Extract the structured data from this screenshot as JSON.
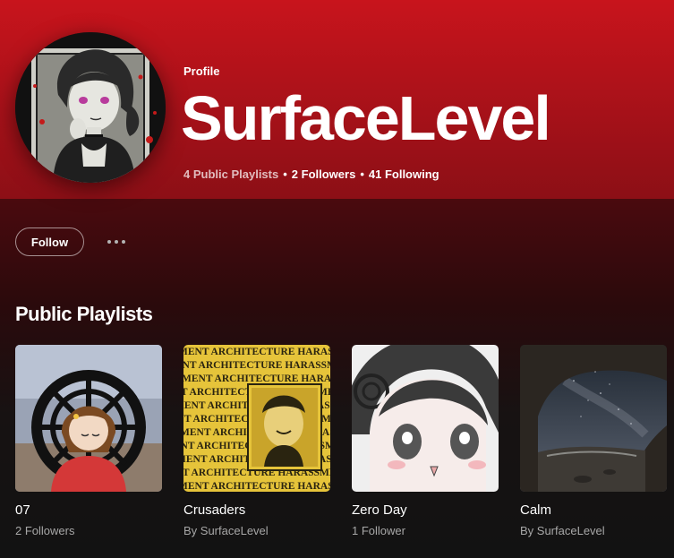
{
  "profile": {
    "label": "Profile",
    "name": "SurfaceLevel",
    "playlists_count": "4 Public Playlists",
    "followers_count": "2 Followers",
    "following_count": "41 Following",
    "separator": "•"
  },
  "actions": {
    "follow_label": "Follow",
    "more_icon": "more-horizontal-icon"
  },
  "section": {
    "title": "Public Playlists"
  },
  "playlists": [
    {
      "title": "07",
      "subtitle": "2 Followers"
    },
    {
      "title": "Crusaders",
      "subtitle": "By SurfaceLevel"
    },
    {
      "title": "Zero Day",
      "subtitle": "1 Follower"
    },
    {
      "title": "Calm",
      "subtitle": "By SurfaceLevel"
    }
  ],
  "cover_text": {
    "pattern_text": "MENT ARCHITECTURE HARASSMENT ARCHITECTURE HARASSMENT ARCHITECTURE HARASS"
  },
  "colors": {
    "header_red": "#c8141c",
    "background": "#121212",
    "muted_text": "#a7a7a7"
  }
}
